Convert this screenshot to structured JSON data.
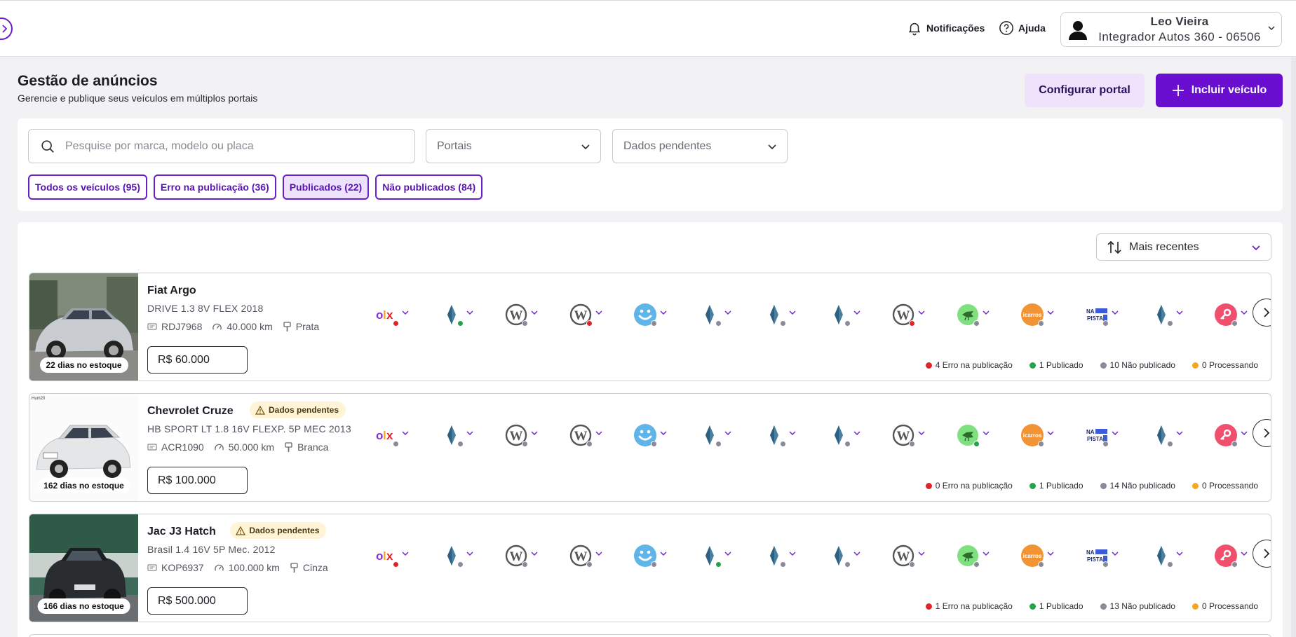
{
  "topbar": {
    "notifications_label": "Notificações",
    "help_label": "Ajuda",
    "user_name": "Leo Vieira",
    "user_company": "Integrador Autos 360 - 06506"
  },
  "header": {
    "title": "Gestão de anúncios",
    "subtitle": "Gerencie e publique seus veículos em múltiplos portais",
    "config_label": "Configurar portal",
    "add_label": "Incluir veículo"
  },
  "filters": {
    "search_placeholder": "Pesquise por marca, modelo ou placa",
    "portals_placeholder": "Portais",
    "pending_placeholder": "Dados pendentes",
    "chips": [
      {
        "label": "Todos os veículos (95)",
        "active": false
      },
      {
        "label": "Erro na publicação (36)",
        "active": false
      },
      {
        "label": "Publicados (22)",
        "active": true
      },
      {
        "label": "Não publicados (84)",
        "active": false
      }
    ]
  },
  "sort": {
    "label": "Mais recentes"
  },
  "pending_badge": "Dados pendentes",
  "colors": {
    "accent": "#6a0fd0",
    "error": "#e0252a",
    "published": "#22a447",
    "not_published": "#8a8a9a",
    "processing": "#f5a623"
  },
  "portal_types": [
    "olx",
    "diamond",
    "wordpress",
    "wordpress",
    "smile",
    "diamond",
    "diamond",
    "diamond",
    "wordpress",
    "green-bird",
    "icarros",
    "napista",
    "diamond",
    "red-key"
  ],
  "vehicles": [
    {
      "name": "Fiat Argo",
      "version": "DRIVE 1.3 8V FLEX 2018",
      "plate": "RDJ7968",
      "km": "40.000 km",
      "color": "Prata",
      "price": "R$ 60.000",
      "days": "22 dias no estoque",
      "pending": false,
      "statuses": [
        "error",
        "published",
        "grey",
        "error",
        "grey",
        "grey",
        "grey",
        "grey",
        "error",
        "grey",
        "grey",
        "grey",
        "grey",
        "grey"
      ],
      "legend": {
        "error": "4 Erro na publicação",
        "published": "1 Publicado",
        "not_published": "10 Não publicado",
        "processing": "0 Processando"
      }
    },
    {
      "name": "Chevrolet Cruze",
      "version": "HB SPORT LT 1.8 16V FLEXP. 5P MEC 2013",
      "plate": "ACR1090",
      "km": "50.000 km",
      "color": "Branca",
      "price": "R$ 100.000",
      "days": "162 dias no estoque",
      "pending": true,
      "statuses": [
        "grey",
        "grey",
        "grey",
        "grey",
        "grey",
        "grey",
        "grey",
        "grey",
        "grey",
        "published",
        "grey",
        "grey",
        "grey",
        "grey"
      ],
      "legend": {
        "error": "0 Erro na publicação",
        "published": "1 Publicado",
        "not_published": "14 Não publicado",
        "processing": "0 Processando"
      }
    },
    {
      "name": "Jac J3 Hatch",
      "version": "Brasil 1.4 16V 5P Mec. 2012",
      "plate": "KOP6937",
      "km": "100.000 km",
      "color": "Cinza",
      "price": "R$ 500.000",
      "days": "166 dias no estoque",
      "pending": true,
      "statuses": [
        "error",
        "grey",
        "grey",
        "grey",
        "grey",
        "published",
        "grey",
        "grey",
        "grey",
        "grey",
        "grey",
        "grey",
        "grey",
        "grey"
      ],
      "legend": {
        "error": "1 Erro na publicação",
        "published": "1 Publicado",
        "not_published": "13 Não publicado",
        "processing": "0 Processando"
      }
    }
  ]
}
